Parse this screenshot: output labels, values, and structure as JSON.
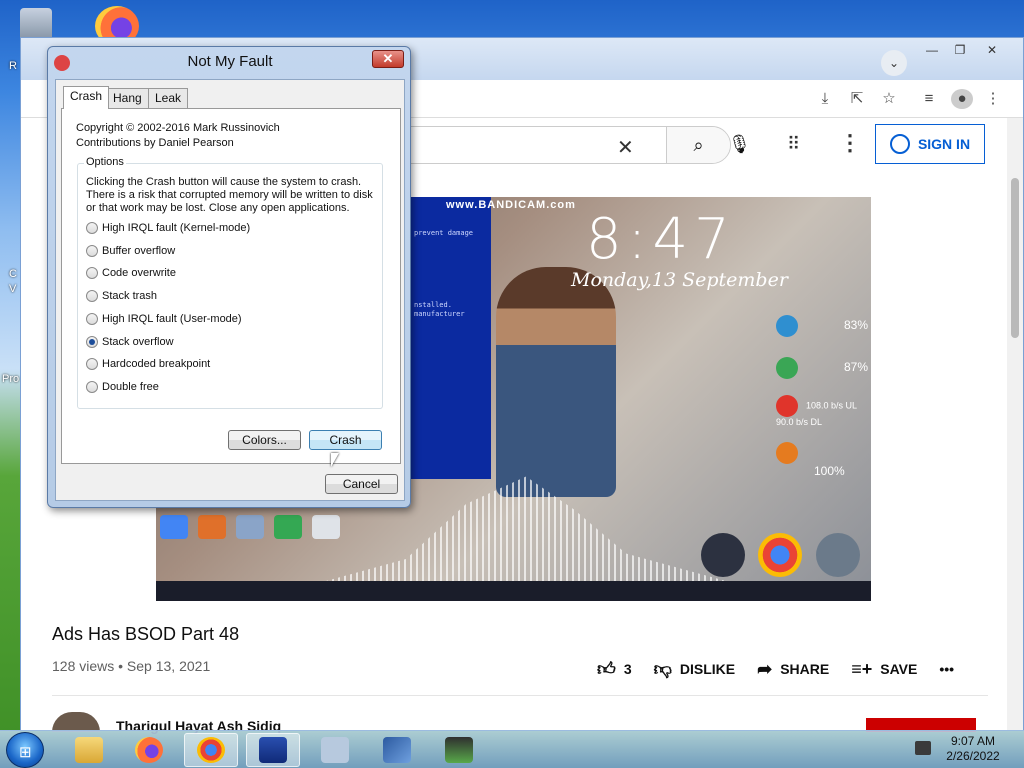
{
  "desktop": {
    "edge_letters": [
      "R",
      "C",
      "V",
      "Pro"
    ]
  },
  "browser": {
    "window_controls": [
      "—",
      "❐",
      "✕"
    ],
    "toolbar_icons": [
      "download-icon",
      "share-icon",
      "star-icon",
      "reading-list-icon",
      "profile-icon",
      "kebab-menu-icon"
    ]
  },
  "youtube": {
    "search_clear": "✕",
    "signin_label": "SIGN IN",
    "video": {
      "watermark": "www.BANDICAM.com",
      "clock": "8:47",
      "date": "Monday,13 September",
      "console_lines": [
        "prevent damage",
        "",
        "",
        "",
        "",
        "",
        "",
        "",
        "",
        "nstalled.",
        "manufacturer"
      ],
      "widgets": [
        {
          "value": "83%",
          "color": "#2f8fd0"
        },
        {
          "value": "87%",
          "color": "#3aa655"
        },
        {
          "value": "108.0 b/s UL  90.0 b/s DL",
          "color": "#e0342b"
        },
        {
          "value": "100%",
          "color": "#e57b1f"
        }
      ]
    },
    "title": "Ads Has BSOD Part 48",
    "meta": "128 views • Sep 13, 2021",
    "actions": {
      "like_count": "3",
      "dislike": "DISLIKE",
      "share": "SHARE",
      "save": "SAVE",
      "more": "•••"
    },
    "channel_name": "Tharigul Hayat Ash Sidiq"
  },
  "dialog": {
    "title": "Not My Fault",
    "tabs": [
      "Crash",
      "Hang",
      "Leak"
    ],
    "active_tab": "Crash",
    "copyright_line1": "Copyright © 2002-2016 Mark Russinovich",
    "copyright_line2": "Contributions by Daniel Pearson",
    "options_label": "Options",
    "description": "Clicking the Crash button will cause the system to crash. There is a risk that corrupted memory will be written to disk or that work may be lost. Close any open applications.",
    "options": [
      {
        "label": "High IRQL fault (Kernel-mode)",
        "checked": false
      },
      {
        "label": "Buffer overflow",
        "checked": false
      },
      {
        "label": "Code overwrite",
        "checked": false
      },
      {
        "label": "Stack trash",
        "checked": false
      },
      {
        "label": "High IRQL fault (User-mode)",
        "checked": false
      },
      {
        "label": "Stack overflow",
        "checked": true
      },
      {
        "label": "Hardcoded breakpoint",
        "checked": false
      },
      {
        "label": "Double free",
        "checked": false
      }
    ],
    "colors_button": "Colors...",
    "crash_button": "Crash",
    "cancel_button": "Cancel"
  },
  "taskbar": {
    "time": "9:07 AM",
    "date": "2/26/2022",
    "start_glyph": "⊞"
  }
}
